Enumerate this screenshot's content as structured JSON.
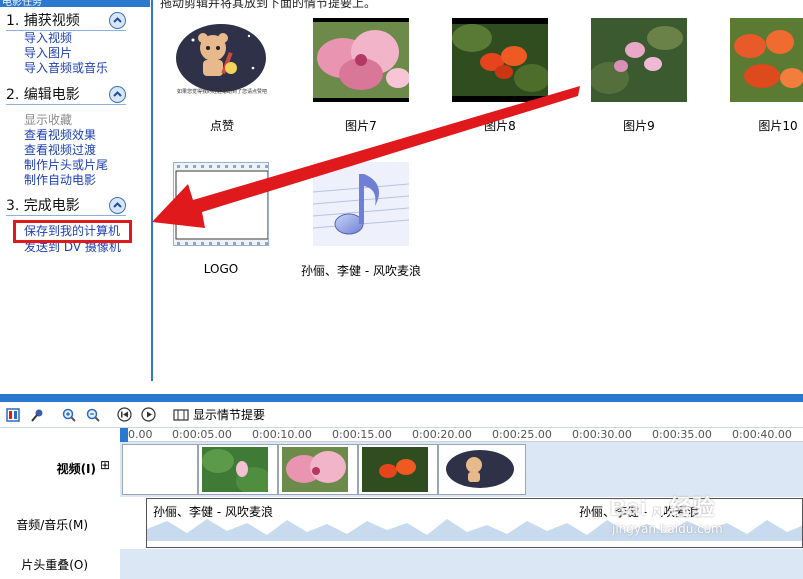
{
  "task_pane": {
    "header_strip": "电影任务",
    "sections": [
      {
        "number_title": "1.  捕获视频",
        "links": [
          "导入视频",
          "导入图片",
          "导入音频或音乐"
        ]
      },
      {
        "number_title": "2.  编辑电影",
        "links": [
          "显示收藏",
          "查看视频效果",
          "查看视频过渡",
          "制作片头或片尾",
          "制作自动电影"
        ]
      },
      {
        "number_title": "3.  完成电影",
        "links": [
          "保存到我的计算机",
          "发送到 DV 摄像机"
        ]
      }
    ]
  },
  "collection": {
    "hint": "拖动剪辑并将其放到下面的情节提要上。",
    "items": [
      {
        "label": "点赞",
        "caption": "如果您觉得我的经验帮助到了您请点赞吧"
      },
      {
        "label": "图片7"
      },
      {
        "label": "图片8"
      },
      {
        "label": "图片9"
      },
      {
        "label": "图片10"
      },
      {
        "label": "LOGO"
      },
      {
        "label": "孙俪、李健 - 风吹麦浪"
      }
    ]
  },
  "timeline": {
    "show_storyboard": "显示情节提要",
    "ticks": [
      "0.00",
      "0:00:05.00",
      "0:00:10.00",
      "0:00:15.00",
      "0:00:20.00",
      "0:00:25.00",
      "0:00:30.00",
      "0:00:35.00",
      "0:00:40.00"
    ],
    "tracks": {
      "video": "视频(I)",
      "video_expand": "⊞",
      "audio": "音频/音乐(M)",
      "overlay": "片头重叠(O)"
    },
    "audio_clip_title_1": "孙俪、李健 - 风吹麦浪",
    "audio_clip_title_2": "孙俪、李健 - 风吹麦浪"
  },
  "watermark": {
    "brand": "Bai",
    "brand2": "经验",
    "url": "jingyan.baidu.com"
  },
  "colors": {
    "accent": "#2b78cf",
    "link": "#1c3fb3",
    "highlight_red": "#e0191c"
  }
}
